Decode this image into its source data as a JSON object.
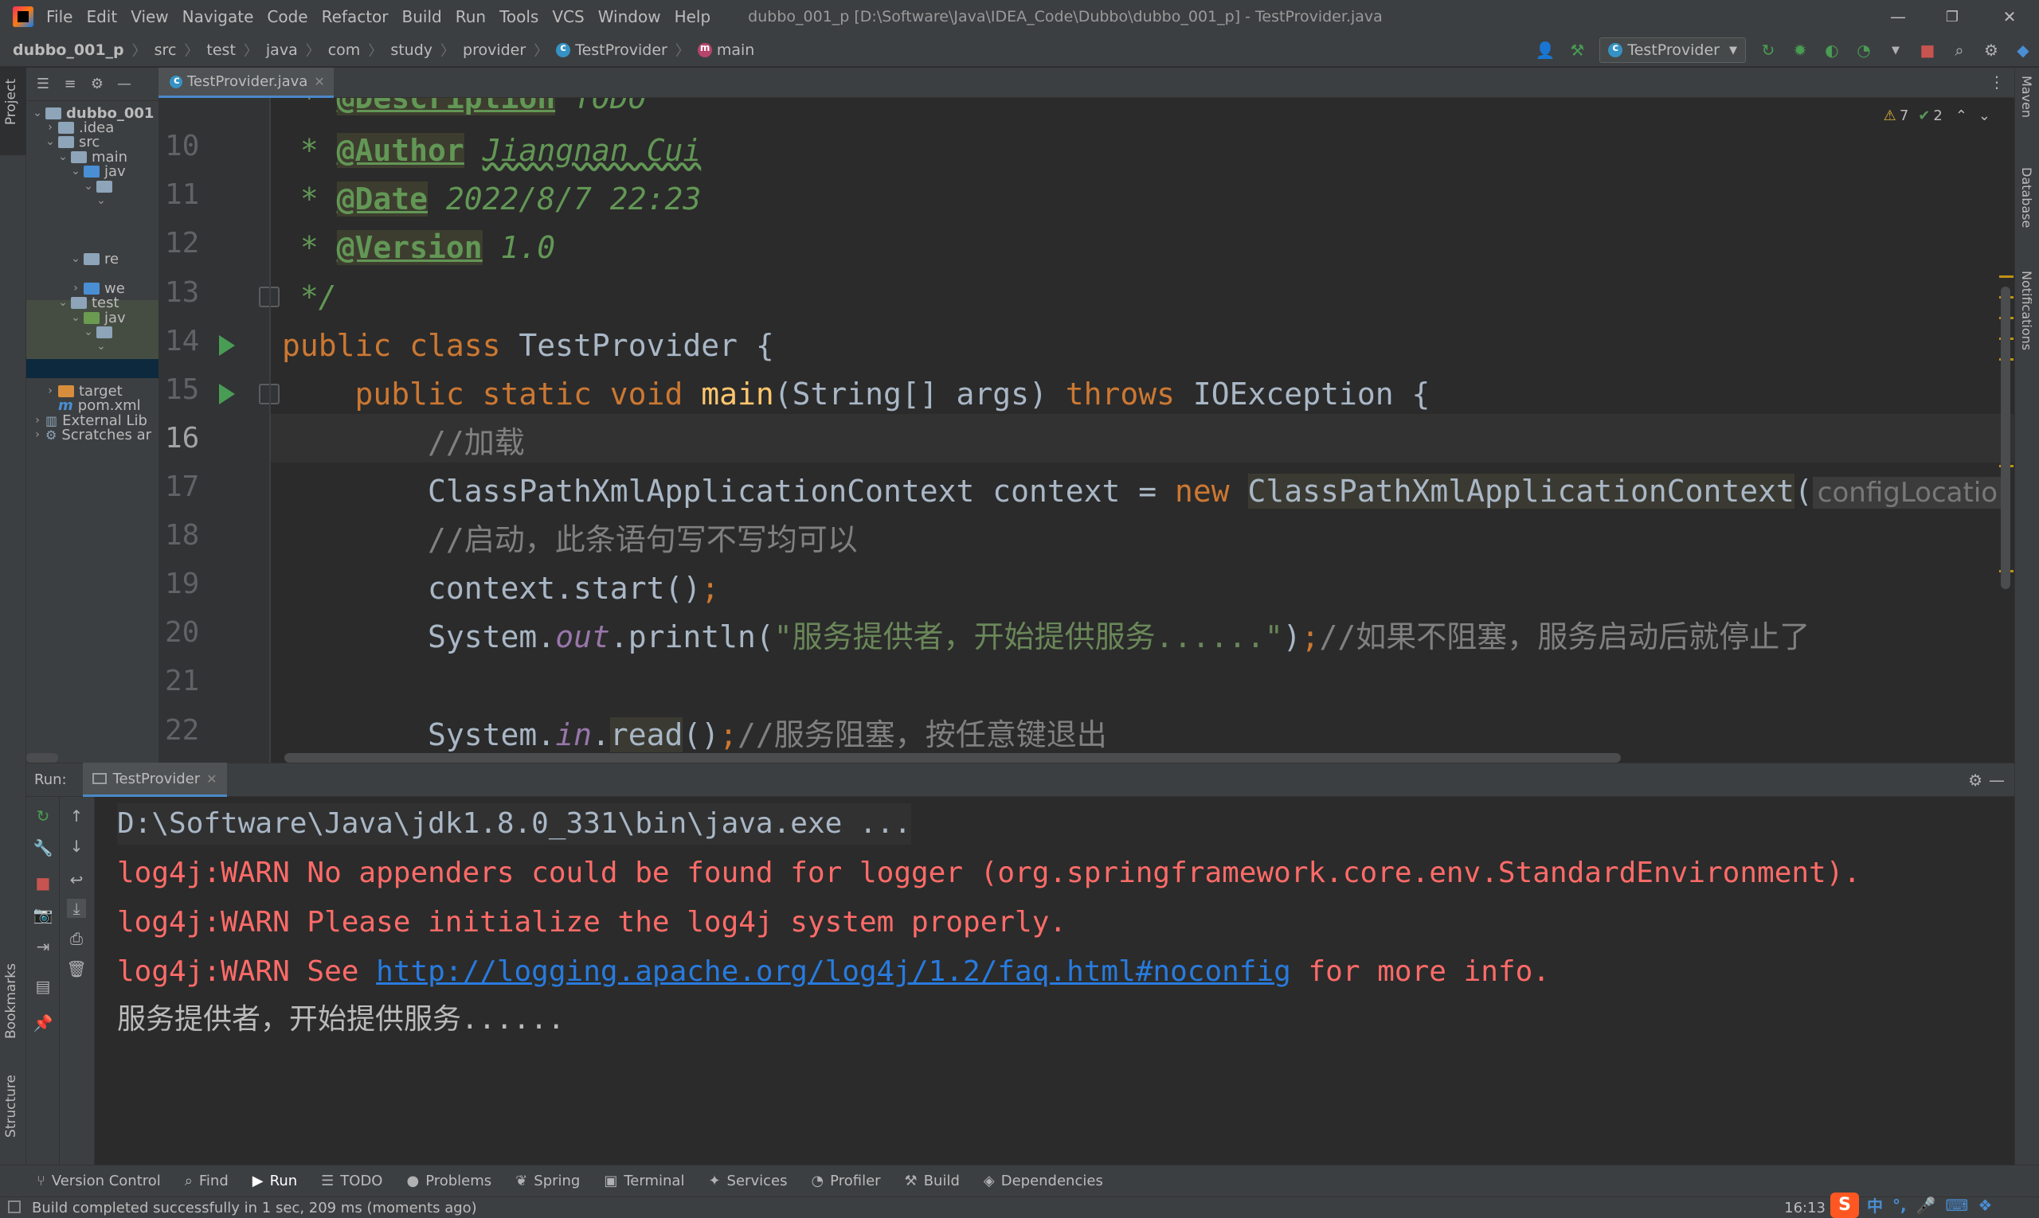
{
  "window": {
    "title": "dubbo_001_p [D:\\Software\\Java\\IDEA_Code\\Dubbo\\dubbo_001_p] - TestProvider.java",
    "minimize": "—",
    "maximize": "❐",
    "close": "✕"
  },
  "menu": [
    "File",
    "Edit",
    "View",
    "Navigate",
    "Code",
    "Refactor",
    "Build",
    "Run",
    "Tools",
    "VCS",
    "Window",
    "Help"
  ],
  "breadcrumbs": [
    "dubbo_001_p",
    "src",
    "test",
    "java",
    "com",
    "study",
    "provider",
    "TestProvider",
    "main"
  ],
  "run_config": {
    "label": "TestProvider"
  },
  "left_strip": {
    "project": "Project",
    "bookmarks": "Bookmarks",
    "structure": "Structure"
  },
  "right_strip": {
    "maven": "Maven",
    "database": "Database",
    "notifications": "Notifications"
  },
  "project_tree": [
    {
      "label": "dubbo_001",
      "indent": 0,
      "arrow": "⌄",
      "icon": "folder",
      "bold": true
    },
    {
      "label": ".idea",
      "indent": 1,
      "arrow": "›",
      "icon": "folder"
    },
    {
      "label": "src",
      "indent": 1,
      "arrow": "⌄",
      "icon": "folder"
    },
    {
      "label": "main",
      "indent": 2,
      "arrow": "⌄",
      "icon": "folder"
    },
    {
      "label": "jav",
      "indent": 3,
      "arrow": "⌄",
      "icon": "folder-blue"
    },
    {
      "label": "",
      "indent": 4,
      "arrow": "⌄",
      "icon": "folder"
    },
    {
      "label": "",
      "indent": 5,
      "arrow": "⌄",
      "icon": ""
    },
    {
      "label": "re",
      "indent": 3,
      "arrow": "⌄",
      "icon": "folder"
    },
    {
      "label": "we",
      "indent": 3,
      "arrow": "›",
      "icon": "folder-blue"
    },
    {
      "label": "test",
      "indent": 2,
      "arrow": "⌄",
      "icon": "folder"
    },
    {
      "label": "jav",
      "indent": 3,
      "arrow": "⌄",
      "icon": "folder-green"
    },
    {
      "label": "",
      "indent": 4,
      "arrow": "⌄",
      "icon": "folder"
    },
    {
      "label": "",
      "indent": 5,
      "arrow": "⌄",
      "icon": ""
    },
    {
      "label": "target",
      "indent": 1,
      "arrow": "›",
      "icon": "folder-orange"
    },
    {
      "label": "pom.xml",
      "indent": 1,
      "arrow": "",
      "icon": "maven"
    },
    {
      "label": "External Lib",
      "indent": 0,
      "arrow": "›",
      "icon": "library"
    },
    {
      "label": "Scratches ar",
      "indent": 0,
      "arrow": "›",
      "icon": "scratch"
    }
  ],
  "editor": {
    "tab": "TestProvider.java",
    "warnings": "7",
    "weak_warnings": "2",
    "line_numbers": [
      "10",
      "11",
      "12",
      "13",
      "14",
      "15",
      "16",
      "17",
      "18",
      "19",
      "20",
      "21",
      "22"
    ],
    "current_line": "16",
    "code": {
      "l9_tag": "@Description",
      "l9_val": " TODO",
      "l10_tag": "@Author",
      "l10_val": "Jiangnan Cui",
      "l11_tag": "@Date",
      "l11_val": " 2022/8/7 22:23",
      "l12_tag": "@Version",
      "l12_val": " 1.0",
      "l13": " */",
      "l14_kw": "public class ",
      "l14_name": "TestProvider {",
      "l15_kw1": "public static void ",
      "l15_fn": "main",
      "l15_args": "(String[] args) ",
      "l15_kw2": "throws ",
      "l15_tail": "IOException {",
      "l16": "//加载",
      "l17_a": "ClassPathXmlApplicationContext context = ",
      "l17_kw": "new ",
      "l17_cls": "ClassPathXmlApplicationContext",
      "l17_paren": "(",
      "l17_hint": "configLocatio",
      "l18": "//启动，此条语句写不写均可以",
      "l19_a": "context.start()",
      "l19_semi": ";",
      "l20_a": "System.",
      "l20_out": "out",
      "l20_b": ".println(",
      "l20_str": "\"服务提供者，开始提供服务......\"",
      "l20_c": ")",
      "l20_semi": ";",
      "l20_cmt": "//如果不阻塞，服务启动后就停止了",
      "l22_a": "System.",
      "l22_in": "in",
      "l22_b": ".",
      "l22_read": "read",
      "l22_c": "()",
      "l22_semi": ";",
      "l22_cmt": "//服务阻塞，按任意键退出"
    }
  },
  "run_panel": {
    "label": "Run:",
    "tab": "TestProvider",
    "console": {
      "cmd": "D:\\Software\\Java\\jdk1.8.0_331\\bin\\java.exe ...",
      "warn1": "log4j:WARN No appenders could be found for logger (org.springframework.core.env.StandardEnvironment).",
      "warn2": "log4j:WARN Please initialize the log4j system properly.",
      "warn3_a": "log4j:WARN See ",
      "warn3_link": "http://logging.apache.org/log4j/1.2/faq.html#noconfig",
      "warn3_b": " for more info.",
      "out": "服务提供者，开始提供服务......"
    }
  },
  "bottom_tools": [
    "Version Control",
    "Find",
    "Run",
    "TODO",
    "Problems",
    "Spring",
    "Terminal",
    "Services",
    "Profiler",
    "Build",
    "Dependencies"
  ],
  "status": {
    "message": "Build completed successfully in 1 sec, 209 ms (moments ago)",
    "time": "16:13",
    "ime_logo": "S",
    "ime_lang": "中",
    "ime_punct": "°,"
  },
  "colors": {
    "keyword": "#cc7832",
    "doc": "#629755",
    "warn": "#ff6b68",
    "link": "#287bde",
    "accent": "#4a88c7"
  }
}
